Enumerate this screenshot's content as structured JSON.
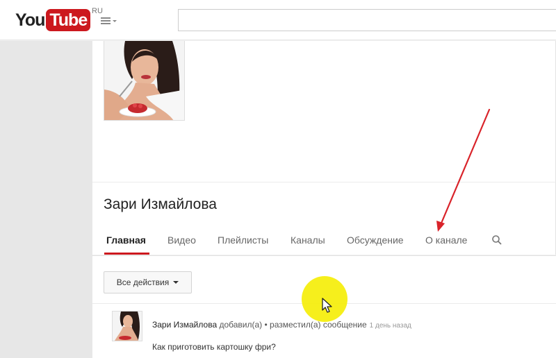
{
  "topbar": {
    "logo_you": "You",
    "logo_tube": "Tube",
    "region": "RU",
    "search_placeholder": ""
  },
  "channel": {
    "name": "Зари Измайлова",
    "tabs": [
      {
        "label": "Главная",
        "active": true
      },
      {
        "label": "Видео",
        "active": false
      },
      {
        "label": "Плейлисты",
        "active": false
      },
      {
        "label": "Каналы",
        "active": false
      },
      {
        "label": "Обсуждение",
        "active": false
      },
      {
        "label": "О канале",
        "active": false
      }
    ]
  },
  "feed": {
    "actions_label": "Все действия",
    "activity": {
      "author": "Зари Измайлова",
      "text": " добавил(а) • разместил(а) сообщение",
      "time": "1 день назад",
      "post": "Как приготовить картошку фри?"
    }
  },
  "colors": {
    "accent": "#cc181e",
    "annotation_arrow": "#d9232a",
    "highlight": "#f6ee10"
  },
  "icons": {
    "guide": "hamburger-menu-icon",
    "channel_search": "magnifier-icon",
    "cursor": "mouse-pointer-icon"
  }
}
